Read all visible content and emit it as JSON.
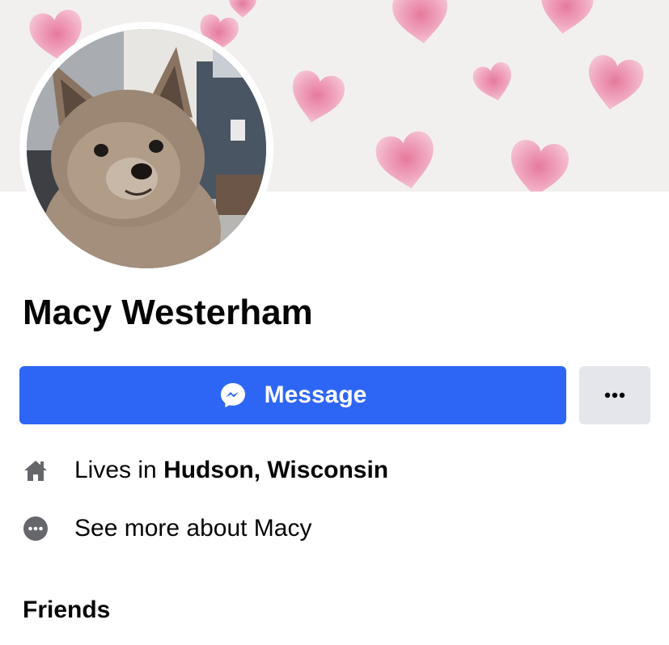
{
  "profile": {
    "name": "Macy Westerham",
    "cover_photo": "pink-watercolor-hearts-cover",
    "profile_photo": "small-dog-profile-photo"
  },
  "actions": {
    "message_label": "Message",
    "message_icon": "messenger-icon",
    "more_icon": "more-options-icon"
  },
  "intro": {
    "lives_prefix": "Lives in ",
    "lives_location": "Hudson, Wisconsin",
    "lives_icon": "home-icon",
    "see_more_label": "See more about Macy",
    "see_more_icon": "more-circle-icon"
  },
  "sections": {
    "friends_heading": "Friends"
  },
  "colors": {
    "primary_button": "#2d66f5",
    "secondary_button": "#e4e6eb",
    "text": "#050505",
    "icon": "#65676b",
    "heart": "#ec8fb0"
  }
}
